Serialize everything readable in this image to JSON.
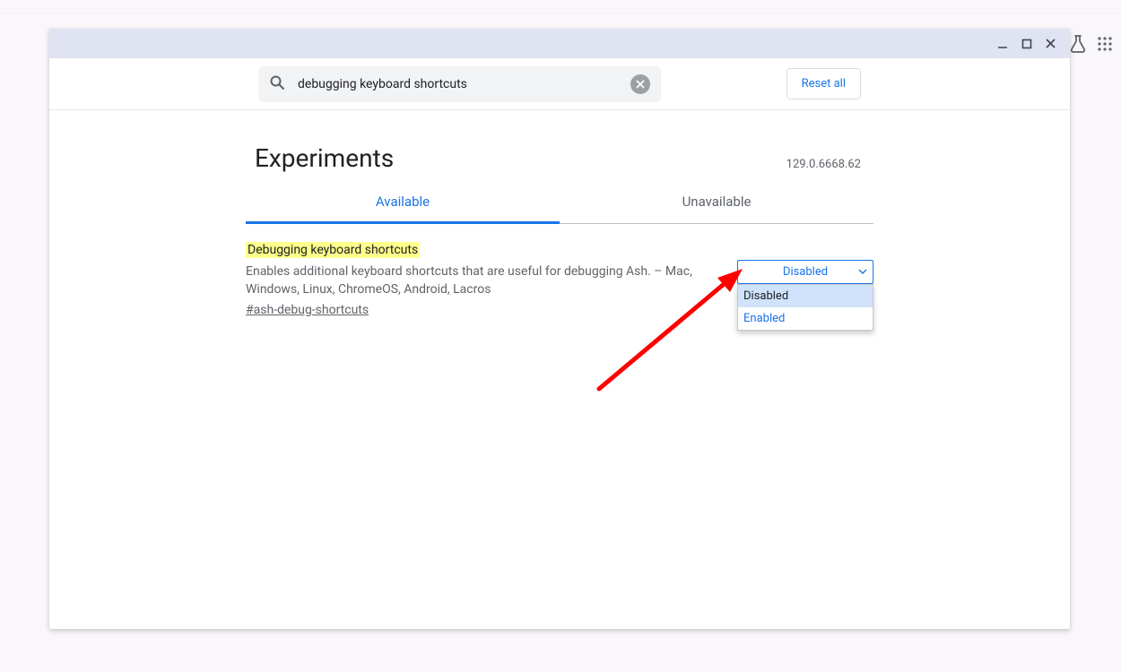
{
  "search": {
    "value": "debugging keyboard shortcuts"
  },
  "toolbar": {
    "reset_label": "Reset all"
  },
  "page": {
    "title": "Experiments",
    "version": "129.0.6668.62"
  },
  "tabs": {
    "available": "Available",
    "unavailable": "Unavailable"
  },
  "flag": {
    "name": "Debugging keyboard shortcuts",
    "description": "Enables additional keyboard shortcuts that are useful for debugging Ash. – Mac, Windows, Linux, ChromeOS, Android, Lacros",
    "hash": "#ash-debug-shortcuts"
  },
  "select": {
    "current": "Disabled",
    "options": [
      "Disabled",
      "Enabled"
    ]
  }
}
